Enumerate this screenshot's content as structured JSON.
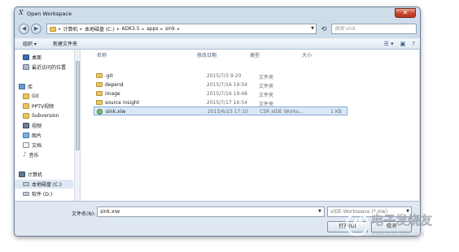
{
  "window": {
    "title": "Open Workspace",
    "close_label": "✕"
  },
  "address": {
    "breadcrumbs": [
      "计算机",
      "本地磁盘 (C:)",
      "ADK3.5",
      "apps",
      "sink"
    ],
    "search_placeholder": "搜索 sink"
  },
  "toolbar": {
    "organize": "组织 ▾",
    "new_folder": "新建文件夹"
  },
  "sidebar": {
    "items": [
      {
        "label": "桌面",
        "icon": "desktop-icon"
      },
      {
        "label": "最近访问的位置",
        "icon": "recent-places-icon"
      },
      {
        "label": "库",
        "icon": "library-icon"
      },
      {
        "label": "Git",
        "icon": "folder-icon"
      },
      {
        "label": "PPTV视频",
        "icon": "folder-icon"
      },
      {
        "label": "Subversion",
        "icon": "folder-icon"
      },
      {
        "label": "视频",
        "icon": "video-icon"
      },
      {
        "label": "图片",
        "icon": "picture-icon"
      },
      {
        "label": "文档",
        "icon": "document-icon"
      },
      {
        "label": "音乐",
        "icon": "music-icon"
      },
      {
        "label": "计算机",
        "icon": "computer-icon"
      },
      {
        "label": "本地磁盘 (C:)",
        "icon": "drive-icon"
      },
      {
        "label": "软件 (D:)",
        "icon": "drive-icon"
      }
    ]
  },
  "file_list": {
    "columns": {
      "name": "名称",
      "date": "修改日期",
      "type": "类型",
      "size": "大小"
    },
    "rows": [
      {
        "name": ".git",
        "date": "2015/7/3 9:20",
        "type": "文件夹",
        "size": ""
      },
      {
        "name": "depend",
        "date": "2015/7/16 19:54",
        "type": "文件夹",
        "size": ""
      },
      {
        "name": "image",
        "date": "2015/7/16 19:48",
        "type": "文件夹",
        "size": ""
      },
      {
        "name": "source insight",
        "date": "2015/7/17 16:54",
        "type": "文件夹",
        "size": ""
      },
      {
        "name": "sink.xiw",
        "date": "2015/6/23 17:10",
        "type": "CSR xIDE Works...",
        "size": "1 KB"
      }
    ]
  },
  "bottom": {
    "filename_label": "文件名(N):",
    "filename_value": "sink.xiw",
    "filter_value": "xIDE Workspace (*.xiw)",
    "open_label": "打开(O)",
    "cancel_label": "取消"
  },
  "watermark": {
    "text": "电子发烧友",
    "url": "www.elecfans.com"
  },
  "colors": {
    "selection": "#d9e8f8",
    "chrome": "#cfdcea",
    "folder": "#e8c764",
    "close": "#c9462c"
  }
}
